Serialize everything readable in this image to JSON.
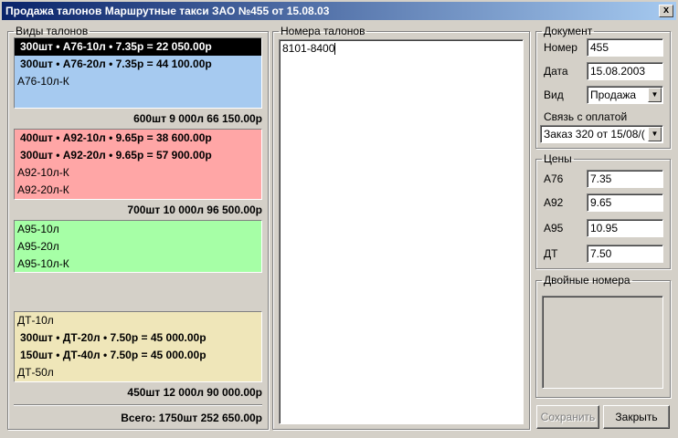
{
  "window": {
    "title": "Продажа талонов Маршрутные такси ЗАО №455 от 15.08.03",
    "close_label": "x"
  },
  "left": {
    "legend": "Виды талонов",
    "blocks": [
      {
        "color": "#a6caf0",
        "rows": [
          "300шт • А76-10л •  7.35р = 22 050.00р",
          "300шт • А76-20л •  7.35р = 44 100.00р",
          "А76-10л-К"
        ],
        "summary": "600шт  9 000л  66 150.00р"
      },
      {
        "color": "#ffa6a6",
        "rows": [
          "400шт • А92-10л •  9.65р = 38 600.00р",
          "300шт • А92-20л •  9.65р = 57 900.00р",
          "А92-10л-К",
          "А92-20л-К"
        ],
        "summary": "700шт  10 000л  96 500.00р"
      },
      {
        "color": "#a6ffa6",
        "rows": [
          "А95-10л",
          "А95-20л",
          "А95-10л-К"
        ]
      },
      {
        "color": "#efe6b9",
        "rows": [
          "ДТ-10л",
          "300шт • ДТ-20л •  7.50р = 45 000.00р",
          "150шт • ДТ-40л •  7.50р = 45 000.00р",
          "ДТ-50л"
        ],
        "summary": "450шт  12 000л  90 000.00р"
      }
    ],
    "total": "Всего:  1750шт  252 650.00р"
  },
  "middle": {
    "legend": "Номера талонов",
    "text": "8101-8400"
  },
  "document": {
    "legend": "Документ",
    "number_label": "Номер",
    "number_value": "455",
    "date_label": "Дата",
    "date_value": "15.08.2003",
    "type_label": "Вид",
    "type_value": "Продажа",
    "payment_label": "Связь с оплатой",
    "payment_value": "Заказ 320 от 15/08/(",
    "arrow": "▼"
  },
  "prices": {
    "legend": "Цены",
    "items": [
      {
        "label": "А76",
        "value": "7.35"
      },
      {
        "label": "А92",
        "value": "9.65"
      },
      {
        "label": "А95",
        "value": "10.95"
      },
      {
        "label": "ДТ",
        "value": "7.50"
      }
    ]
  },
  "duplicates": {
    "legend": "Двойные номера"
  },
  "buttons": {
    "save": "Сохранить",
    "close": "Закрыть"
  }
}
